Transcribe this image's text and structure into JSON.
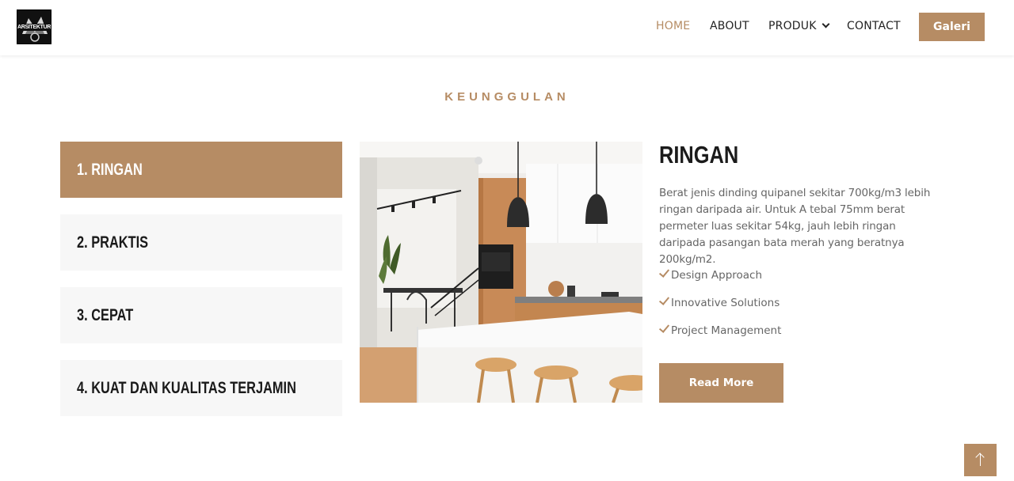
{
  "header": {
    "logo_text": "ARSITEKTUR",
    "nav": [
      {
        "label": "HOME",
        "active": true
      },
      {
        "label": "ABOUT",
        "active": false
      },
      {
        "label": "PRODUK",
        "active": false,
        "has_dropdown": true
      },
      {
        "label": "CONTACT",
        "active": false
      }
    ],
    "cta_label": "Galeri"
  },
  "section": {
    "title": "KEUNGGULAN"
  },
  "tabs": [
    {
      "label": "1. RINGAN",
      "active": true
    },
    {
      "label": "2. PRAKTIS",
      "active": false
    },
    {
      "label": "3. CEPAT",
      "active": false
    },
    {
      "label": "4. KUAT DAN KUALITAS TERJAMIN",
      "active": false
    }
  ],
  "content": {
    "title": "RINGAN",
    "description": "Berat jenis dinding quipanel sekitar 700kg/m3 lebih ringan daripada air. Untuk A tebal 75mm berat permeter luas sekitar 54kg, jauh lebih ringan daripada pasangan bata merah yang beratnya 200kg/m2.",
    "features": [
      "Design Approach",
      "Innovative Solutions",
      "Project Management"
    ],
    "read_more_label": "Read More"
  },
  "colors": {
    "accent": "#b68c64",
    "tab_bg": "#f7f7f7",
    "heading": "#1b1b1b",
    "body_text": "#666666"
  },
  "icons": {
    "dropdown": "chevron-down-icon",
    "feature_check": "check-icon",
    "back_to_top": "arrow-up-icon"
  }
}
